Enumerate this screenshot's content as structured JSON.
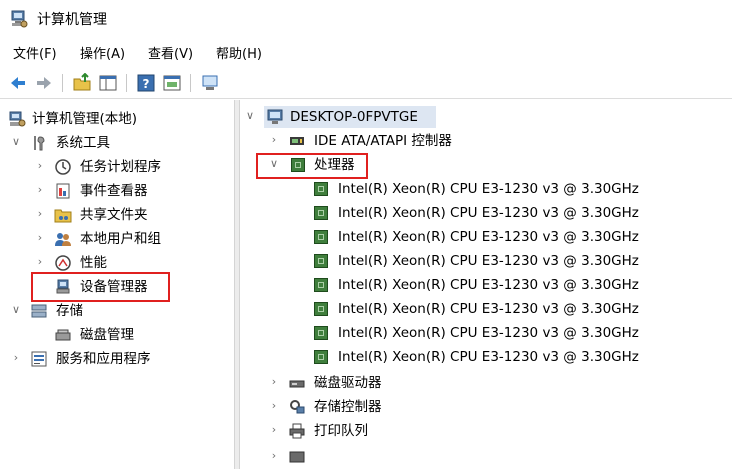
{
  "window": {
    "title": "计算机管理"
  },
  "menu": [
    "文件(F)",
    "操作(A)",
    "查看(V)",
    "帮助(H)"
  ],
  "left_tree": {
    "root": "计算机管理(本地)",
    "system_tools": "系统工具",
    "system_children": [
      "任务计划程序",
      "事件查看器",
      "共享文件夹",
      "本地用户和组",
      "性能",
      "设备管理器"
    ],
    "storage": "存储",
    "storage_children": [
      "磁盘管理"
    ],
    "services": "服务和应用程序"
  },
  "right_tree": {
    "computer": "DESKTOP-0FPVTGE",
    "ide": "IDE ATA/ATAPI 控制器",
    "processors": "处理器",
    "cpus": [
      "Intel(R) Xeon(R) CPU E3-1230 v3 @ 3.30GHz",
      "Intel(R) Xeon(R) CPU E3-1230 v3 @ 3.30GHz",
      "Intel(R) Xeon(R) CPU E3-1230 v3 @ 3.30GHz",
      "Intel(R) Xeon(R) CPU E3-1230 v3 @ 3.30GHz",
      "Intel(R) Xeon(R) CPU E3-1230 v3 @ 3.30GHz",
      "Intel(R) Xeon(R) CPU E3-1230 v3 @ 3.30GHz",
      "Intel(R) Xeon(R) CPU E3-1230 v3 @ 3.30GHz",
      "Intel(R) Xeon(R) CPU E3-1230 v3 @ 3.30GHz"
    ],
    "disk_drives": "磁盘驱动器",
    "storage_controllers": "存储控制器",
    "print_queue": "打印队列"
  },
  "colors": {
    "highlight_box": "#e0201f",
    "chip": "#3f7e3c",
    "selection": "#dde6f2"
  }
}
